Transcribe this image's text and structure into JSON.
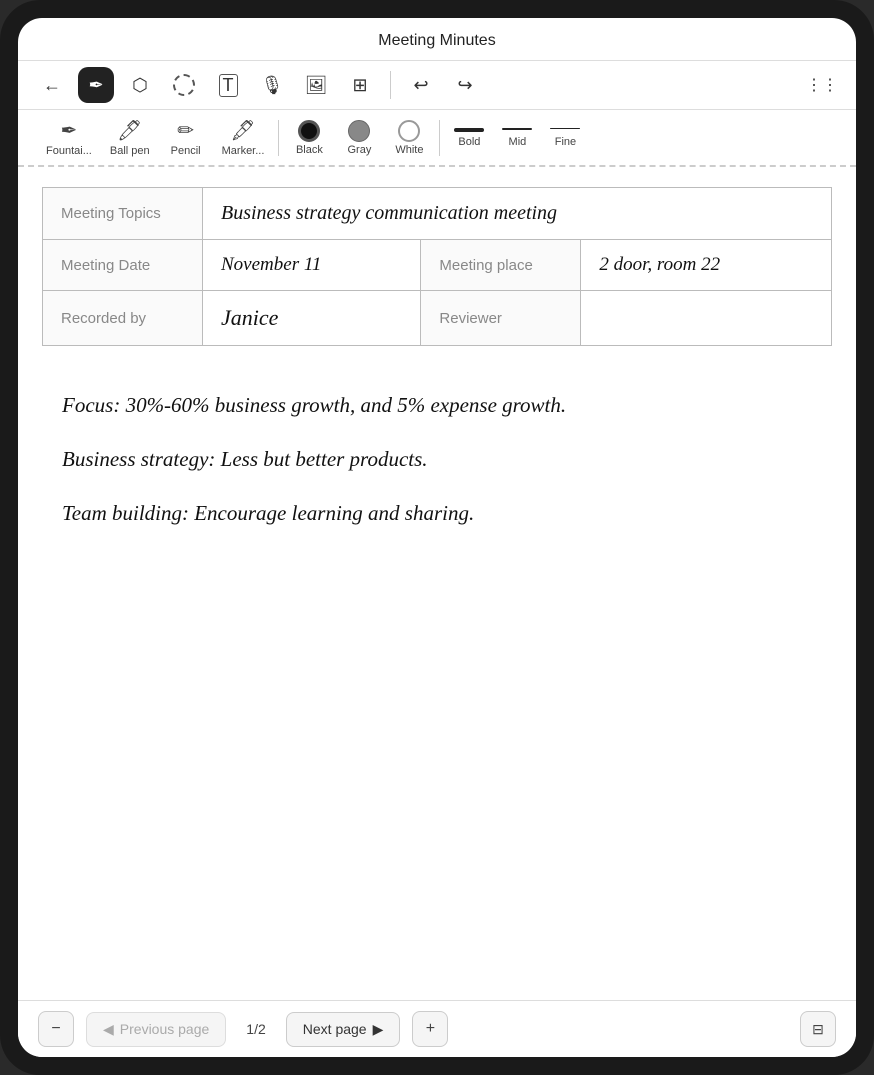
{
  "app": {
    "title": "Meeting Minutes"
  },
  "toolbar": {
    "back_icon": "←",
    "pen_icon": "✏",
    "eraser_icon": "◻",
    "lasso_icon": "⊙",
    "text_icon": "T",
    "mic_icon": "🎤",
    "image_icon": "🖼",
    "table_icon": "⊞",
    "undo_icon": "↩",
    "redo_icon": "↪",
    "more_icon": "⋮⋮"
  },
  "sub_toolbar": {
    "pen_types": [
      {
        "label": "Fountai...",
        "icon": "✒"
      },
      {
        "label": "Ball pen",
        "icon": "🖊"
      },
      {
        "label": "Pencil",
        "icon": "✏"
      },
      {
        "label": "Marker...",
        "icon": "🖋"
      }
    ],
    "colors": [
      {
        "label": "Black",
        "value": "black",
        "selected": true
      },
      {
        "label": "Gray",
        "value": "gray",
        "selected": false
      },
      {
        "label": "White",
        "value": "white",
        "selected": false
      }
    ],
    "strokes": [
      {
        "label": "Bold",
        "thickness": 4
      },
      {
        "label": "Mid",
        "thickness": 2
      },
      {
        "label": "Fine",
        "thickness": 1
      }
    ]
  },
  "table": {
    "rows": [
      {
        "cells": [
          {
            "type": "label",
            "text": "Meeting Topics",
            "colspan": 1
          },
          {
            "type": "handwriting",
            "text": "Business strategy communication meeting",
            "colspan": 3
          }
        ]
      },
      {
        "cells": [
          {
            "type": "label",
            "text": "Meeting Date"
          },
          {
            "type": "handwriting",
            "text": "November 11"
          },
          {
            "type": "label",
            "text": "Meeting place"
          },
          {
            "type": "handwriting",
            "text": "2 door, room 22"
          }
        ]
      },
      {
        "cells": [
          {
            "type": "label",
            "text": "Recorded by"
          },
          {
            "type": "handwriting",
            "text": "Janice"
          },
          {
            "type": "label",
            "text": "Reviewer"
          },
          {
            "type": "handwriting",
            "text": ""
          }
        ]
      }
    ]
  },
  "notes": [
    "Focus: 30%-60% business growth, and 5% expense growth.",
    "Business strategy: Less but better products.",
    "Team building: Encourage learning and sharing."
  ],
  "bottom_nav": {
    "prev_label": "Previous page",
    "page_indicator": "1/2",
    "next_label": "Next page",
    "minus_icon": "−",
    "plus_icon": "+",
    "layout_icon": "⊟"
  }
}
